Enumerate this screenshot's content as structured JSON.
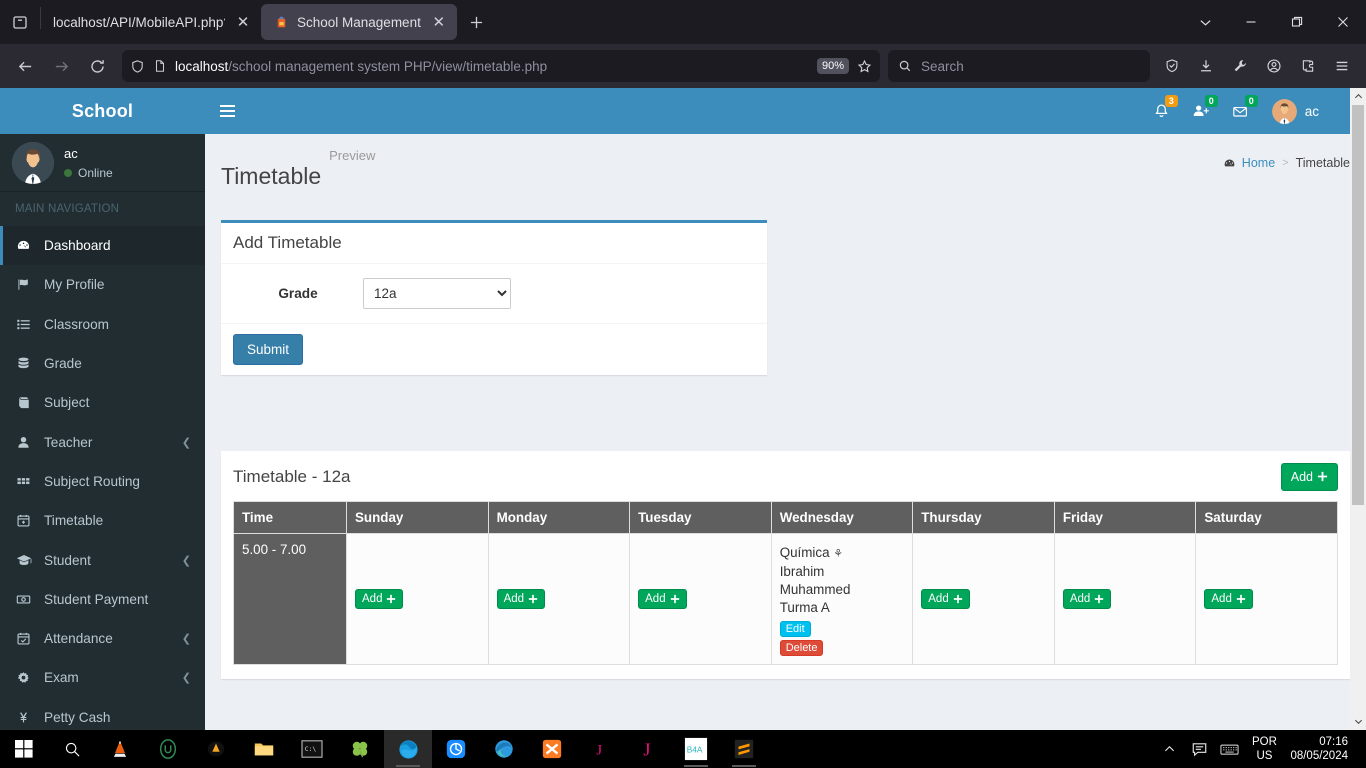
{
  "browser": {
    "tabs": [
      {
        "title": "localhost/API/MobileAPI.php?action",
        "active": false,
        "favicon": "generic-page-icon"
      },
      {
        "title": "School Management",
        "active": true,
        "favicon": "school-backpack-icon"
      }
    ],
    "new_tab_label": "+",
    "url_host": "localhost",
    "url_path": "/school management system PHP/view/timetable.php",
    "zoom_level": "90%",
    "search_placeholder": "Search",
    "toolbar_icons": [
      "shield-icon",
      "download-icon",
      "wrench-icon",
      "account-icon",
      "extensions-icon",
      "app-menu-icon"
    ],
    "window_controls": [
      "list-all-tabs-icon",
      "minimize-icon",
      "restore-icon",
      "close-icon"
    ]
  },
  "sidebar": {
    "brand": "School",
    "user": {
      "name": "ac",
      "status": "Online"
    },
    "nav_header": "MAIN NAVIGATION",
    "items": [
      {
        "label": "Dashboard",
        "icon": "dashboard-icon",
        "active": true,
        "caret": false
      },
      {
        "label": "My Profile",
        "icon": "flag-icon",
        "active": false,
        "caret": false
      },
      {
        "label": "Classroom",
        "icon": "list-icon",
        "active": false,
        "caret": false
      },
      {
        "label": "Grade",
        "icon": "database-icon",
        "active": false,
        "caret": false
      },
      {
        "label": "Subject",
        "icon": "book-icon",
        "active": false,
        "caret": false
      },
      {
        "label": "Teacher",
        "icon": "user-icon",
        "active": false,
        "caret": true
      },
      {
        "label": "Subject Routing",
        "icon": "grid-icon",
        "active": false,
        "caret": false
      },
      {
        "label": "Timetable",
        "icon": "calendar-plus-icon",
        "active": false,
        "caret": false
      },
      {
        "label": "Student",
        "icon": "graduation-cap-icon",
        "active": false,
        "caret": true
      },
      {
        "label": "Student Payment",
        "icon": "money-icon",
        "active": false,
        "caret": false
      },
      {
        "label": "Attendance",
        "icon": "calendar-check-icon",
        "active": false,
        "caret": true
      },
      {
        "label": "Exam",
        "icon": "gear-icon",
        "active": false,
        "caret": true
      },
      {
        "label": "Petty Cash",
        "icon": "yen-icon",
        "active": false,
        "caret": false
      }
    ]
  },
  "topbar": {
    "menu_toggle": "hamburger-icon",
    "notifications": {
      "icon": "bell-icon",
      "count": "3",
      "badge_color": "#f39c12"
    },
    "users": {
      "icon": "add-user-icon",
      "count": "0",
      "badge_color": "#00a65a"
    },
    "messages": {
      "icon": "envelope-icon",
      "count": "0",
      "badge_color": "#00a65a"
    },
    "user_name": "ac"
  },
  "page": {
    "title": "Timetable",
    "subtitle": "Preview",
    "breadcrumb": {
      "home": "Home",
      "separator": ">",
      "current": "Timetable"
    }
  },
  "add_form": {
    "box_title": "Add Timetable",
    "grade_label": "Grade",
    "grade_value": "12a",
    "grade_options": [
      "12a"
    ],
    "submit_label": "Submit"
  },
  "timetable": {
    "box_title": "Timetable - 12a",
    "add_label": "Add",
    "columns": [
      "Time",
      "Sunday",
      "Monday",
      "Tuesday",
      "Wednesday",
      "Thursday",
      "Friday",
      "Saturday"
    ],
    "rows": [
      {
        "time": "5.00 - 7.00",
        "cells": [
          {
            "day": "Sunday",
            "filled": false,
            "add_label": "Add"
          },
          {
            "day": "Monday",
            "filled": false,
            "add_label": "Add"
          },
          {
            "day": "Tuesday",
            "filled": false,
            "add_label": "Add"
          },
          {
            "day": "Wednesday",
            "filled": true,
            "lines": [
              "Química",
              "Ibrahim",
              "Muhammed",
              "Turma A"
            ],
            "subject_icon": "missing-glyph-icon",
            "edit_label": "Edit",
            "delete_label": "Delete"
          },
          {
            "day": "Thursday",
            "filled": false,
            "add_label": "Add"
          },
          {
            "day": "Friday",
            "filled": false,
            "add_label": "Add"
          },
          {
            "day": "Saturday",
            "filled": false,
            "add_label": "Add"
          }
        ]
      }
    ]
  },
  "taskbar": {
    "start": "windows-start-icon",
    "search": "search-icon",
    "apps": [
      "vlc-icon",
      "u-circle-icon",
      "avast-icon",
      "file-explorer-icon",
      "terminal-icon",
      "clover-icon",
      "firefox-icon",
      "uc-browser-icon",
      "edge-icon",
      "xampp-icon",
      "jetbrains-j-icon",
      "jetbrains-j2-icon",
      "b4a-icon",
      "sublime-text-icon"
    ],
    "tray": {
      "chevron": "show-hidden-icons-icon",
      "icons": [
        "chat-icon",
        "keyboard-icon"
      ],
      "language_line1": "POR",
      "language_line2": "US",
      "time": "07:16",
      "date": "08/05/2024"
    }
  },
  "colors": {
    "brand_blue": "#3c8dbc",
    "sidebar_dark": "#222d32",
    "page_bg": "#ecf0f5",
    "success_green": "#00a65a",
    "info_blue": "#00c0ef",
    "danger_red": "#dd4b39",
    "table_header_gray": "#5f5f5f"
  }
}
